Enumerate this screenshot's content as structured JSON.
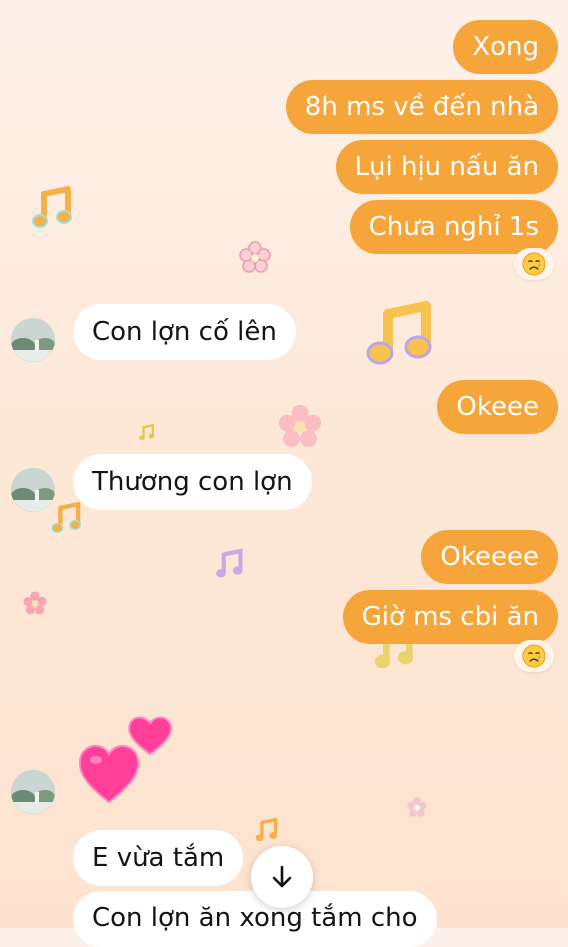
{
  "messages": [
    {
      "sender": "me",
      "text": "Xong"
    },
    {
      "sender": "me",
      "text": "8h ms về đến nhà"
    },
    {
      "sender": "me",
      "text": "Lụi hịu nấu ăn"
    },
    {
      "sender": "me",
      "text": "Chưa nghỉ 1s",
      "reaction": "crying-face"
    },
    {
      "sender": "them",
      "text": "Con lợn cố lên"
    },
    {
      "sender": "me",
      "text": "Okeee"
    },
    {
      "sender": "them",
      "text": "Thương con lợn"
    },
    {
      "sender": "me",
      "text": "Okeeee"
    },
    {
      "sender": "me",
      "text": "Giờ ms cbi ăn",
      "reaction": "crying-face"
    },
    {
      "sender": "them",
      "sticker": "two-hearts"
    },
    {
      "sender": "them",
      "text": "E vừa tắm"
    },
    {
      "sender": "them",
      "text": "Con lợn ăn xong tắm cho"
    }
  ],
  "scroll_button": {
    "icon": "arrow-down-icon"
  },
  "colors": {
    "outgoing": "#f5a53a",
    "incoming": "#ffffff",
    "heart": "#ff3f9a"
  }
}
